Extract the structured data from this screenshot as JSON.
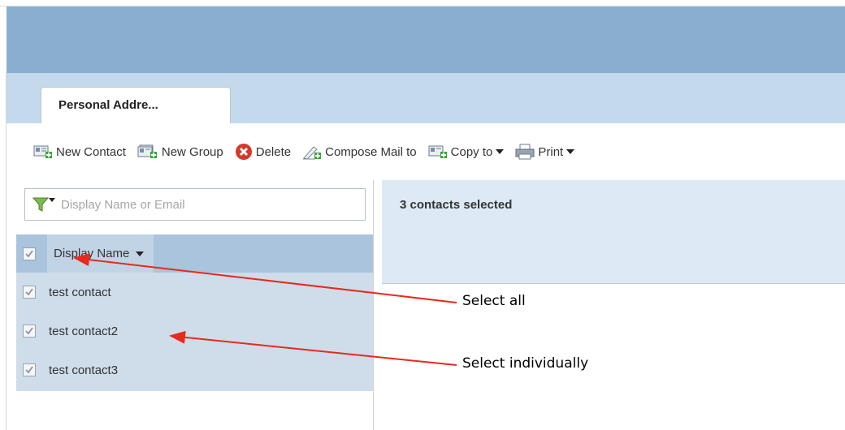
{
  "tabs": [
    {
      "label": "Personal Addre..."
    }
  ],
  "toolbar": {
    "items": [
      {
        "label": "New Contact",
        "icon": "new-contact-icon"
      },
      {
        "label": "New Group",
        "icon": "new-group-icon"
      },
      {
        "label": "Delete",
        "icon": "delete-icon"
      },
      {
        "label": "Compose Mail to",
        "icon": "compose-mail-icon"
      },
      {
        "label": "Copy to",
        "icon": "copy-icon"
      },
      {
        "label": "Print",
        "icon": "print-icon"
      }
    ]
  },
  "search": {
    "placeholder": "Display Name or Email",
    "filter_icon": "filter-icon"
  },
  "list": {
    "column_header": "Display Name",
    "select_all_checked": true,
    "rows": [
      {
        "name": "test contact",
        "checked": true
      },
      {
        "name": "test contact2",
        "checked": true
      },
      {
        "name": "test contact3",
        "checked": true
      }
    ]
  },
  "detail": {
    "title": "3 contacts selected"
  },
  "annotations": {
    "select_all": "Select all",
    "select_individually": "Select individually"
  },
  "colors": {
    "header_band": "#8aaecf",
    "tab_band": "#c5d9ec",
    "list_selected": "#cfdcea",
    "annotation_arrow": "#e8291c"
  }
}
